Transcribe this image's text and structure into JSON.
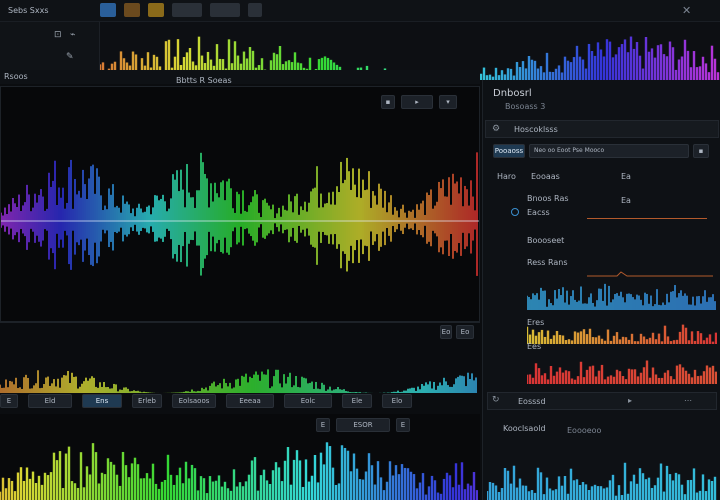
{
  "topbar": {
    "title": "Sebs Sxxs",
    "tabs": [
      "",
      "",
      "",
      "",
      ""
    ]
  },
  "left": {
    "track_label": "Rsoos",
    "editor_title": "Bbtts R Soeas",
    "lower_tabs": [
      "E",
      "Eld",
      "Ens",
      "Erleb",
      "Eolsaoos",
      "Eeeaa",
      "Eolc",
      "Ele",
      "Elo"
    ],
    "mini_buttons": [
      "Eo",
      "Eo"
    ],
    "bottom_btns": [
      "E",
      "ESOR",
      "E"
    ]
  },
  "right": {
    "header_title": "Dnbosrl",
    "header_sub": "Bosoass 3",
    "panel_title": "Hoscoklsss",
    "search_tab": "Pooaoss",
    "search_placeholder": "Neo oo Eoot Pse Mooco",
    "rows": [
      {
        "label": "Haro",
        "sub": "Eooaas",
        "value": "Ea"
      },
      {
        "label": "Bnoos Ras",
        "sub": "Eacss",
        "value": "Ea"
      },
      {
        "label": "Boooseet",
        "sub": "Ress Rans",
        "value": ""
      },
      {
        "label": "Eres",
        "sub": "",
        "value": ""
      },
      {
        "label": "Ees",
        "sub": "",
        "value": ""
      },
      {
        "label": "Eoo",
        "sub": "",
        "value": ""
      }
    ],
    "footer_label": "Eosssd",
    "bottom_title": "Kooclsaold",
    "bottom_sub": "Eoooeoo"
  },
  "colors": {
    "accent": "#1f6fb0",
    "bg": "#0b0d10",
    "panel": "#111418"
  }
}
